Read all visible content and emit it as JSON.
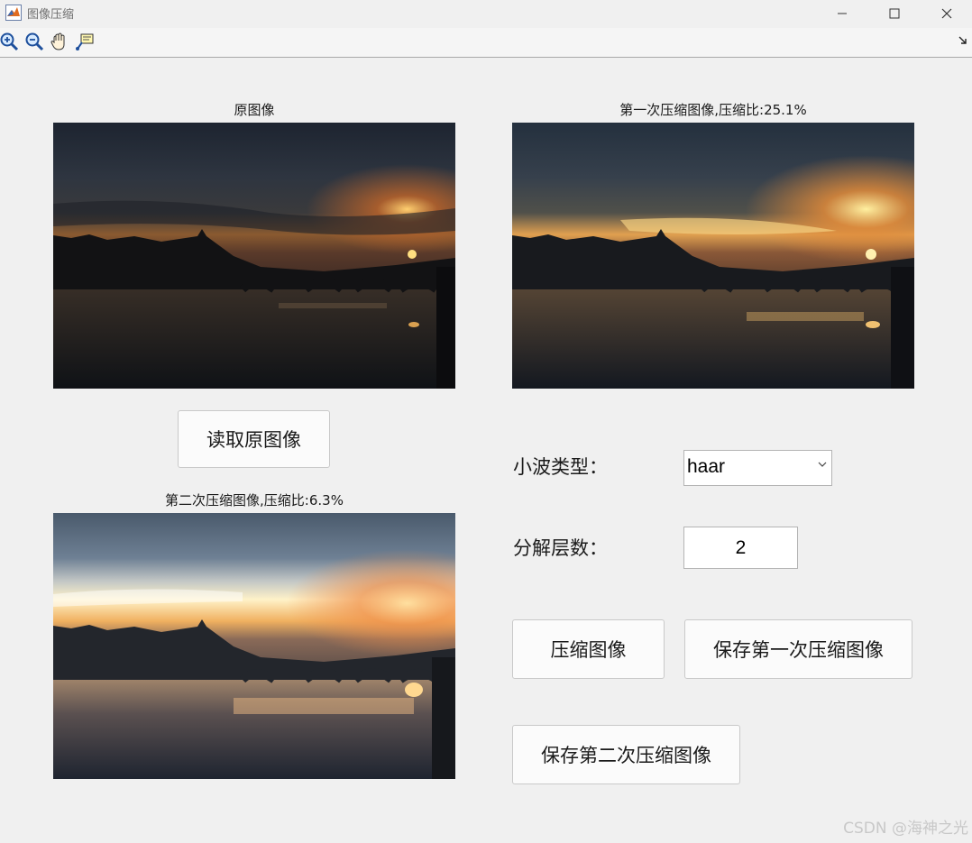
{
  "window": {
    "title": "图像压缩",
    "icon": "matlab-logo-icon",
    "controls": [
      "minimize-icon",
      "maximize-icon",
      "close-icon"
    ]
  },
  "toolbar": {
    "tools": [
      "zoom-in-icon",
      "zoom-out-icon",
      "pan-hand-icon",
      "data-cursor-icon"
    ],
    "expand_icon": "corner-arrow-icon"
  },
  "axes": {
    "original_title": "原图像",
    "first_title": "第一次压缩图像,压缩比:25.1%",
    "second_title": "第二次压缩图像,压缩比:6.3%"
  },
  "controls": {
    "read_button": "读取原图像",
    "wavelet_label": "小波类型：",
    "wavelet_value": "haar",
    "levels_label": "分解层数：",
    "levels_value": "2",
    "compress_button": "压缩图像",
    "save_first_button": "保存第一次压缩图像",
    "save_second_button": "保存第二次压缩图像"
  },
  "watermark": "CSDN @海神之光"
}
